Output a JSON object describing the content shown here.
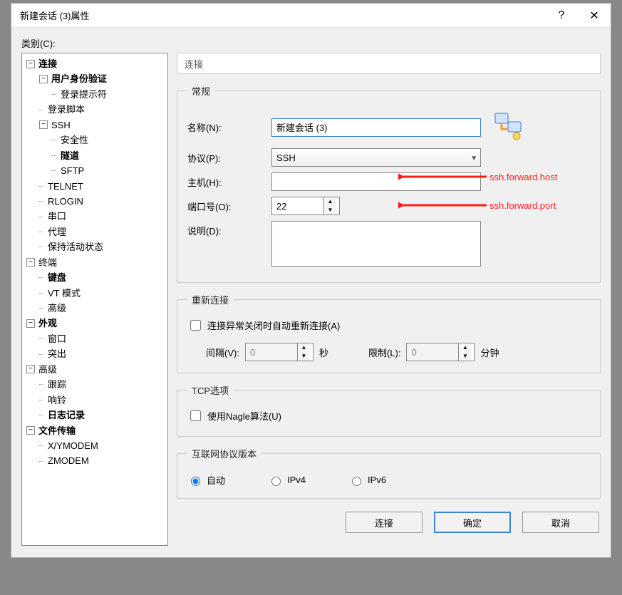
{
  "window": {
    "title": "新建会话 (3)属性",
    "help_icon": "?",
    "close_icon": "✕"
  },
  "category_label": "类别(C):",
  "tree": {
    "items": [
      {
        "depth": 0,
        "toggle": "-",
        "label": "连接",
        "bold": true
      },
      {
        "depth": 1,
        "toggle": "-",
        "label": "用户身份验证",
        "bold": true
      },
      {
        "depth": 2,
        "label": "登录提示符"
      },
      {
        "depth": 1,
        "label": "登录脚本"
      },
      {
        "depth": 1,
        "toggle": "-",
        "label": "SSH"
      },
      {
        "depth": 2,
        "label": "安全性"
      },
      {
        "depth": 2,
        "label": "隧道",
        "bold": true
      },
      {
        "depth": 2,
        "label": "SFTP"
      },
      {
        "depth": 1,
        "label": "TELNET"
      },
      {
        "depth": 1,
        "label": "RLOGIN"
      },
      {
        "depth": 1,
        "label": "串口"
      },
      {
        "depth": 1,
        "label": "代理"
      },
      {
        "depth": 1,
        "label": "保持活动状态"
      },
      {
        "depth": 0,
        "toggle": "-",
        "label": "终端"
      },
      {
        "depth": 1,
        "label": "键盘",
        "bold": true
      },
      {
        "depth": 1,
        "label": "VT 模式"
      },
      {
        "depth": 1,
        "label": "高级"
      },
      {
        "depth": 0,
        "toggle": "-",
        "label": "外观",
        "bold": true
      },
      {
        "depth": 1,
        "label": "窗口"
      },
      {
        "depth": 1,
        "label": "突出"
      },
      {
        "depth": 0,
        "toggle": "-",
        "label": "高级"
      },
      {
        "depth": 1,
        "label": "跟踪"
      },
      {
        "depth": 1,
        "label": "响铃"
      },
      {
        "depth": 1,
        "label": "日志记录",
        "bold": true
      },
      {
        "depth": 0,
        "toggle": "-",
        "label": "文件传输",
        "bold": true
      },
      {
        "depth": 1,
        "label": "X/YMODEM"
      },
      {
        "depth": 1,
        "label": "ZMODEM"
      }
    ]
  },
  "panel": {
    "section_title": "连接",
    "general": {
      "legend": "常规",
      "name_label": "名称(N):",
      "name_value": "新建会话 (3)",
      "protocol_label": "协议(P):",
      "protocol_value": "SSH",
      "host_label": "主机(H):",
      "host_value": "",
      "port_label": "端口号(O):",
      "port_value": "22",
      "desc_label": "说明(D):",
      "desc_value": ""
    },
    "reconnect": {
      "legend": "重新连接",
      "checkbox_label": "连接异常关闭时自动重新连接(A)",
      "interval_label": "间隔(V):",
      "interval_value": "0",
      "interval_unit": "秒",
      "limit_label": "限制(L):",
      "limit_value": "0",
      "limit_unit": "分钟"
    },
    "tcp": {
      "legend": "TCP选项",
      "nagle_label": "使用Nagle算法(U)"
    },
    "ip": {
      "legend": "互联网协议版本",
      "auto": "自动",
      "ipv4": "IPv4",
      "ipv6": "IPv6"
    }
  },
  "annotations": {
    "host_hint": "ssh.forward.host",
    "port_hint": "ssh.forward.port"
  },
  "buttons": {
    "connect": "连接",
    "ok": "确定",
    "cancel": "取消"
  }
}
